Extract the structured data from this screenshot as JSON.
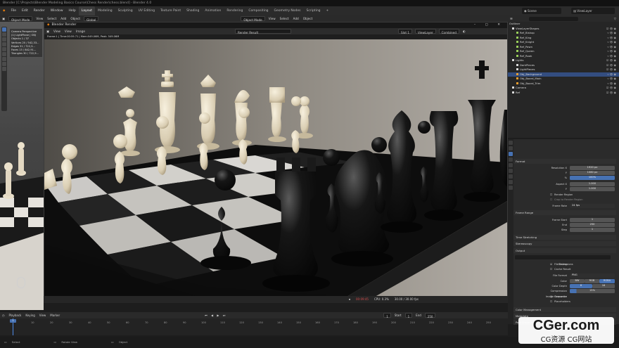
{
  "app": {
    "title": "Blender [C:\\Projects\\Blender Modeling Basics Course\\Chess Render\\chess.blend] - Blender 4.0"
  },
  "menu": [
    "File",
    "Edit",
    "Render",
    "Window",
    "Help"
  ],
  "workspaces": [
    "Layout",
    "Modeling",
    "Sculpting",
    "UV Editing",
    "Texture Paint",
    "Shading",
    "Animation",
    "Rendering",
    "Compositing",
    "Geometry Nodes",
    "Scripting"
  ],
  "scene": {
    "label": "Scene",
    "view_layer": "ViewLayer"
  },
  "viewport_header": {
    "mode": "Object Mode",
    "items": [
      "View",
      "Select",
      "Add",
      "Object"
    ],
    "transform": "Global",
    "mode_right": "Object Mode",
    "items_right": [
      "View",
      "Select",
      "Add",
      "Object"
    ]
  },
  "stats": {
    "title": "Camera Perspective",
    "subtitle": "(1) LightPlane | OBJ",
    "rows": [
      "Objects  1 / 37",
      "Vertices  20 / 542,33...",
      "Edges  31 / 722,3...",
      "Faces  13 / 842,91...",
      "Triangles  30 / 722,9..."
    ]
  },
  "render_window": {
    "title": "Blender Render",
    "menu": [
      "View",
      "View",
      "Image"
    ],
    "image_name": "Render Result",
    "slot": "Slot 1",
    "view_layer": "ViewLayer",
    "pass": "Combined",
    "info": "Frame:1 | Time:00:59.71 | Mem:549.06M, Peak: 549.06M",
    "status_time": "00:09:45",
    "status_cpu": "CPU: 0.3%",
    "status_frame": "30.00 / 30.00 fps"
  },
  "outliner": {
    "title": "Outliner",
    "rows": [
      "ViewLayerShapes",
      "Ref_Bishop",
      "Ref_King",
      "Ref_Knight",
      "Ref_Pawn",
      "Ref_Queen",
      "Ref_Rook",
      "Lights",
      "DarkPieces",
      "LightPieces",
      "Obj_Background",
      "Obj_Board_Main",
      "Obj_Board_Trim",
      "Camera",
      "Ref"
    ]
  },
  "properties": {
    "sections": [
      "Format",
      "Frame Range",
      "Time Stretching",
      "Stereoscopy",
      "Output",
      "Color Management",
      "Metadata",
      "Post Processing"
    ],
    "resolution_x": "1920 px",
    "resolution_y": "1080 px",
    "resolution_pct": "100%",
    "aspect_x": "1.000",
    "aspect_y": "1.000",
    "render_region": "Render Region",
    "crop": "Crop to Render Region",
    "frame_rate": "24 fps",
    "frame_start": "1",
    "frame_end": "250",
    "frame_step": "1",
    "saving": "Saving",
    "file_extensions": "File Extensions",
    "cache_result": "Cache Result",
    "file_format": "PNG",
    "color_modes": [
      "BW",
      "RGB",
      "RGBA"
    ],
    "color_depths": [
      "8",
      "16"
    ],
    "compression": "15%",
    "overwrite": "Overwrite",
    "placeholders": "Placeholders",
    "labels": {
      "resolution_x": "Resolution X",
      "y": "Y",
      "pct": "%",
      "aspect_x": "Aspect X",
      "frame_rate": "Frame Rate",
      "frame_start": "Frame Start",
      "end": "End",
      "step": "Step",
      "color": "Color",
      "color_depth": "Color Depth",
      "compression": "Compression",
      "file_format": "File Format",
      "image_sequence": "Image Sequence"
    }
  },
  "timeline": {
    "menu": [
      "Playback",
      "Keying",
      "View",
      "Marker"
    ],
    "current_frame": "1",
    "start_label": "Start",
    "start": "1",
    "end_label": "End",
    "end": "250",
    "ticks": [
      "10",
      "20",
      "30",
      "40",
      "50",
      "60",
      "70",
      "80",
      "90",
      "100",
      "110",
      "120",
      "130",
      "140",
      "150",
      "160",
      "170",
      "180",
      "190",
      "200",
      "210",
      "220",
      "230",
      "240",
      "250"
    ]
  },
  "statusbar": [
    "Select",
    "Rotate View",
    "Object"
  ],
  "watermark": {
    "main": "CGer.com",
    "sub": "CG资源 CG网站"
  }
}
